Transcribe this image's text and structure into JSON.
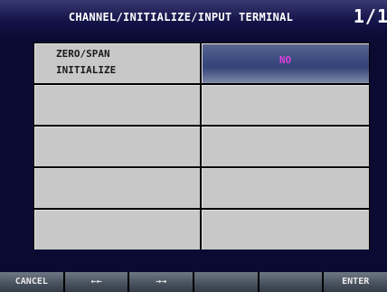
{
  "header": {
    "title": "CHANNEL/INITIALIZE/INPUT TERMINAL",
    "page": "1/1"
  },
  "items": [
    {
      "label": "ZERO/SPAN\nINITIALIZE",
      "value": "NO"
    },
    {
      "label": "",
      "value": ""
    },
    {
      "label": "",
      "value": ""
    },
    {
      "label": "",
      "value": ""
    },
    {
      "label": "",
      "value": ""
    }
  ],
  "softkeys": [
    "CANCEL",
    "←←",
    "→→",
    "",
    "",
    "ENTER"
  ],
  "colors": {
    "header_bg": "#14144a",
    "panel_bg": "#0a0a32",
    "cell_bg": "#c8c8c8",
    "selected_value_bg": "#3a4a7e",
    "value_text": "#e040e0"
  }
}
